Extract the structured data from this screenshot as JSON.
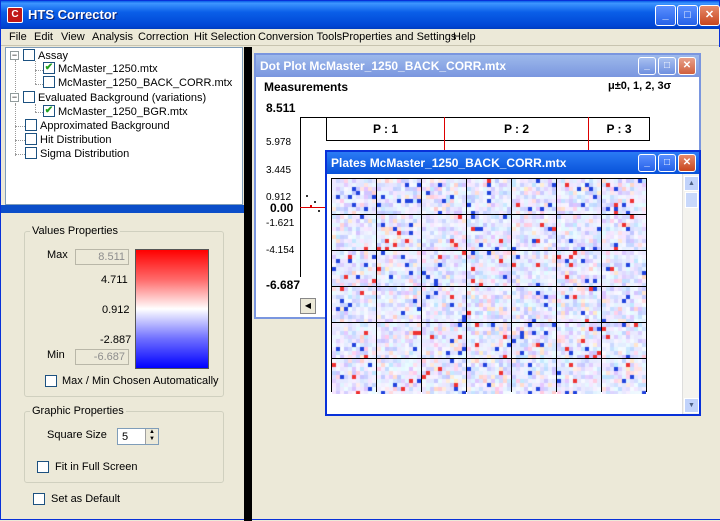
{
  "app": {
    "title": "HTS Corrector",
    "icon_letter": "C"
  },
  "menu": [
    "File",
    "Edit",
    "View",
    "Analysis",
    "Correction",
    "Hit Selection",
    "Conversion Tools",
    "Properties and Settings",
    "Help"
  ],
  "tree": {
    "items": [
      {
        "label": "Assay",
        "checked": false,
        "expander": "−"
      },
      {
        "label": "McMaster_1250.mtx",
        "checked": true
      },
      {
        "label": "McMaster_1250_BACK_CORR.mtx",
        "checked": false
      },
      {
        "label": "Evaluated Background (variations)",
        "checked": false,
        "expander": "−"
      },
      {
        "label": "McMaster_1250_BGR.mtx",
        "checked": true
      },
      {
        "label": "Approximated Background",
        "checked": false
      },
      {
        "label": "Hit Distribution",
        "checked": false
      },
      {
        "label": "Sigma Distribution",
        "checked": false
      }
    ]
  },
  "values_properties": {
    "title": "Values Properties",
    "max_label": "Max",
    "max_value": "8.511",
    "min_label": "Min",
    "min_value": "-6.687",
    "scale_labels": [
      "4.711",
      "0.912",
      "-2.887"
    ],
    "auto_label": "Max / Min Chosen Automatically",
    "auto_checked": false
  },
  "graphic_properties": {
    "title": "Graphic Properties",
    "square_size_label": "Square Size",
    "square_size_value": "5",
    "full_screen_label": "Fit in Full Screen",
    "full_screen_checked": false
  },
  "set_default_label": "Set as Default",
  "dot_plot": {
    "title": "Dot Plot McMaster_1250_BACK_CORR.mtx",
    "heading": "Measurements",
    "sigma_label": "μ±0, 1, 2, 3σ",
    "y_labels": [
      "8.511",
      "5.978",
      "3.445",
      "0.912",
      "0.00",
      "-1.621",
      "-4.154",
      "-6.687"
    ],
    "plates": [
      "P : 1",
      "P : 2",
      "P : 3"
    ]
  },
  "plates_window": {
    "title": "Plates McMaster_1250_BACK_CORR.mtx"
  },
  "window_buttons": {
    "minimize": "_",
    "maximize": "□",
    "close": "✕"
  }
}
